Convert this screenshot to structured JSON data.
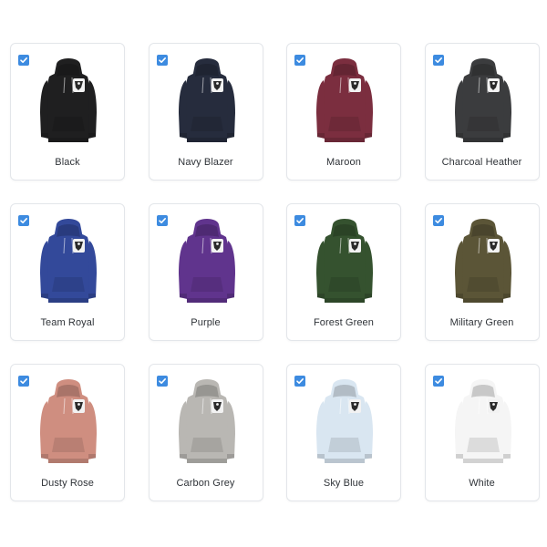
{
  "variants": [
    {
      "label": "Black",
      "color": "#1f1f20",
      "checked": true
    },
    {
      "label": "Navy Blazer",
      "color": "#262c3d",
      "checked": true
    },
    {
      "label": "Maroon",
      "color": "#7b2e3f",
      "checked": true
    },
    {
      "label": "Charcoal Heather",
      "color": "#3b3c3e",
      "checked": true
    },
    {
      "label": "Team Royal",
      "color": "#33499a",
      "checked": true
    },
    {
      "label": "Purple",
      "color": "#60348d",
      "checked": true
    },
    {
      "label": "Forest Green",
      "color": "#35522f",
      "checked": true
    },
    {
      "label": "Military Green",
      "color": "#5b5537",
      "checked": true
    },
    {
      "label": "Dusty Rose",
      "color": "#cf8e80",
      "checked": true
    },
    {
      "label": "Carbon Grey",
      "color": "#b9b7b3",
      "checked": true
    },
    {
      "label": "Sky Blue",
      "color": "#d9e6f1",
      "checked": true
    },
    {
      "label": "White",
      "color": "#f5f5f5",
      "checked": true
    }
  ],
  "colors": {
    "checkbox": "#3d8be0",
    "card_border": "#e3e6ea",
    "label_text": "#2f3338"
  },
  "icons": {
    "checkbox": "checkmark-icon",
    "product": "hoodie-icon",
    "graphic": "mascot-graphic"
  }
}
